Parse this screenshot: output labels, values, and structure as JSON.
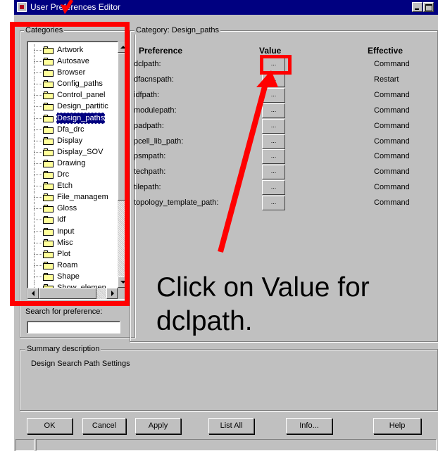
{
  "window": {
    "title": "User Preferences Editor"
  },
  "categories": {
    "group_label": "Categories",
    "items": [
      {
        "label": "Artwork"
      },
      {
        "label": "Autosave"
      },
      {
        "label": "Browser"
      },
      {
        "label": "Config_paths"
      },
      {
        "label": "Control_panel"
      },
      {
        "label": "Design_partitic"
      },
      {
        "label": "Design_paths",
        "selected": true
      },
      {
        "label": "Dfa_drc"
      },
      {
        "label": "Display"
      },
      {
        "label": "Display_SOV"
      },
      {
        "label": "Drawing"
      },
      {
        "label": "Drc"
      },
      {
        "label": "Etch"
      },
      {
        "label": "File_managem"
      },
      {
        "label": "Gloss"
      },
      {
        "label": "Idf"
      },
      {
        "label": "Input"
      },
      {
        "label": "Misc"
      },
      {
        "label": "Plot"
      },
      {
        "label": "Roam"
      },
      {
        "label": "Shape"
      },
      {
        "label": "Show_elemen"
      }
    ],
    "search_label": "Search for preference:",
    "search_value": ""
  },
  "preferences": {
    "category_label": "Category:",
    "category_value": "Design_paths",
    "headers": {
      "preference": "Preference",
      "value": "Value",
      "effective": "Effective"
    },
    "value_button_label": "...",
    "rows": [
      {
        "name": "dclpath:",
        "effective": "Command"
      },
      {
        "name": "dfacnspath:",
        "effective": "Restart"
      },
      {
        "name": "idfpath:",
        "effective": "Command"
      },
      {
        "name": "modulepath:",
        "effective": "Command"
      },
      {
        "name": "padpath:",
        "effective": "Command"
      },
      {
        "name": "pcell_lib_path:",
        "effective": "Command"
      },
      {
        "name": "psmpath:",
        "effective": "Command"
      },
      {
        "name": "techpath:",
        "effective": "Command"
      },
      {
        "name": "tilepath:",
        "effective": "Command"
      },
      {
        "name": "topology_template_path:",
        "effective": "Command"
      }
    ]
  },
  "summary": {
    "group_label": "Summary description",
    "text": "Design Search Path Settings"
  },
  "buttons": {
    "ok": "OK",
    "cancel": "Cancel",
    "apply": "Apply",
    "list_all": "List All",
    "info": "Info...",
    "help": "Help"
  },
  "annotation": {
    "text_line1": "Click on Value for",
    "text_line2": "dclpath.",
    "color": "#ff0000"
  }
}
